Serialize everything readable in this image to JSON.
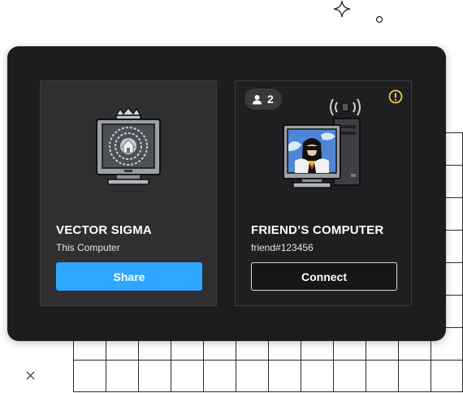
{
  "devices": [
    {
      "name": "VECTOR SIGMA",
      "subtitle": "This Computer",
      "action_label": "Share"
    },
    {
      "name": "FRIEND’S COMPUTER",
      "subtitle": "friend#123456",
      "action_label": "Connect",
      "user_count": "2"
    }
  ],
  "colors": {
    "panel": "#1d1d1f",
    "share_button": "#2ea6ff",
    "warning": "#f2c94c"
  },
  "icons": [
    "sparkle-icon",
    "circle-icon",
    "close-icon",
    "user-icon",
    "warning-icon",
    "home-monitor-icon",
    "friend-computer-icon"
  ]
}
